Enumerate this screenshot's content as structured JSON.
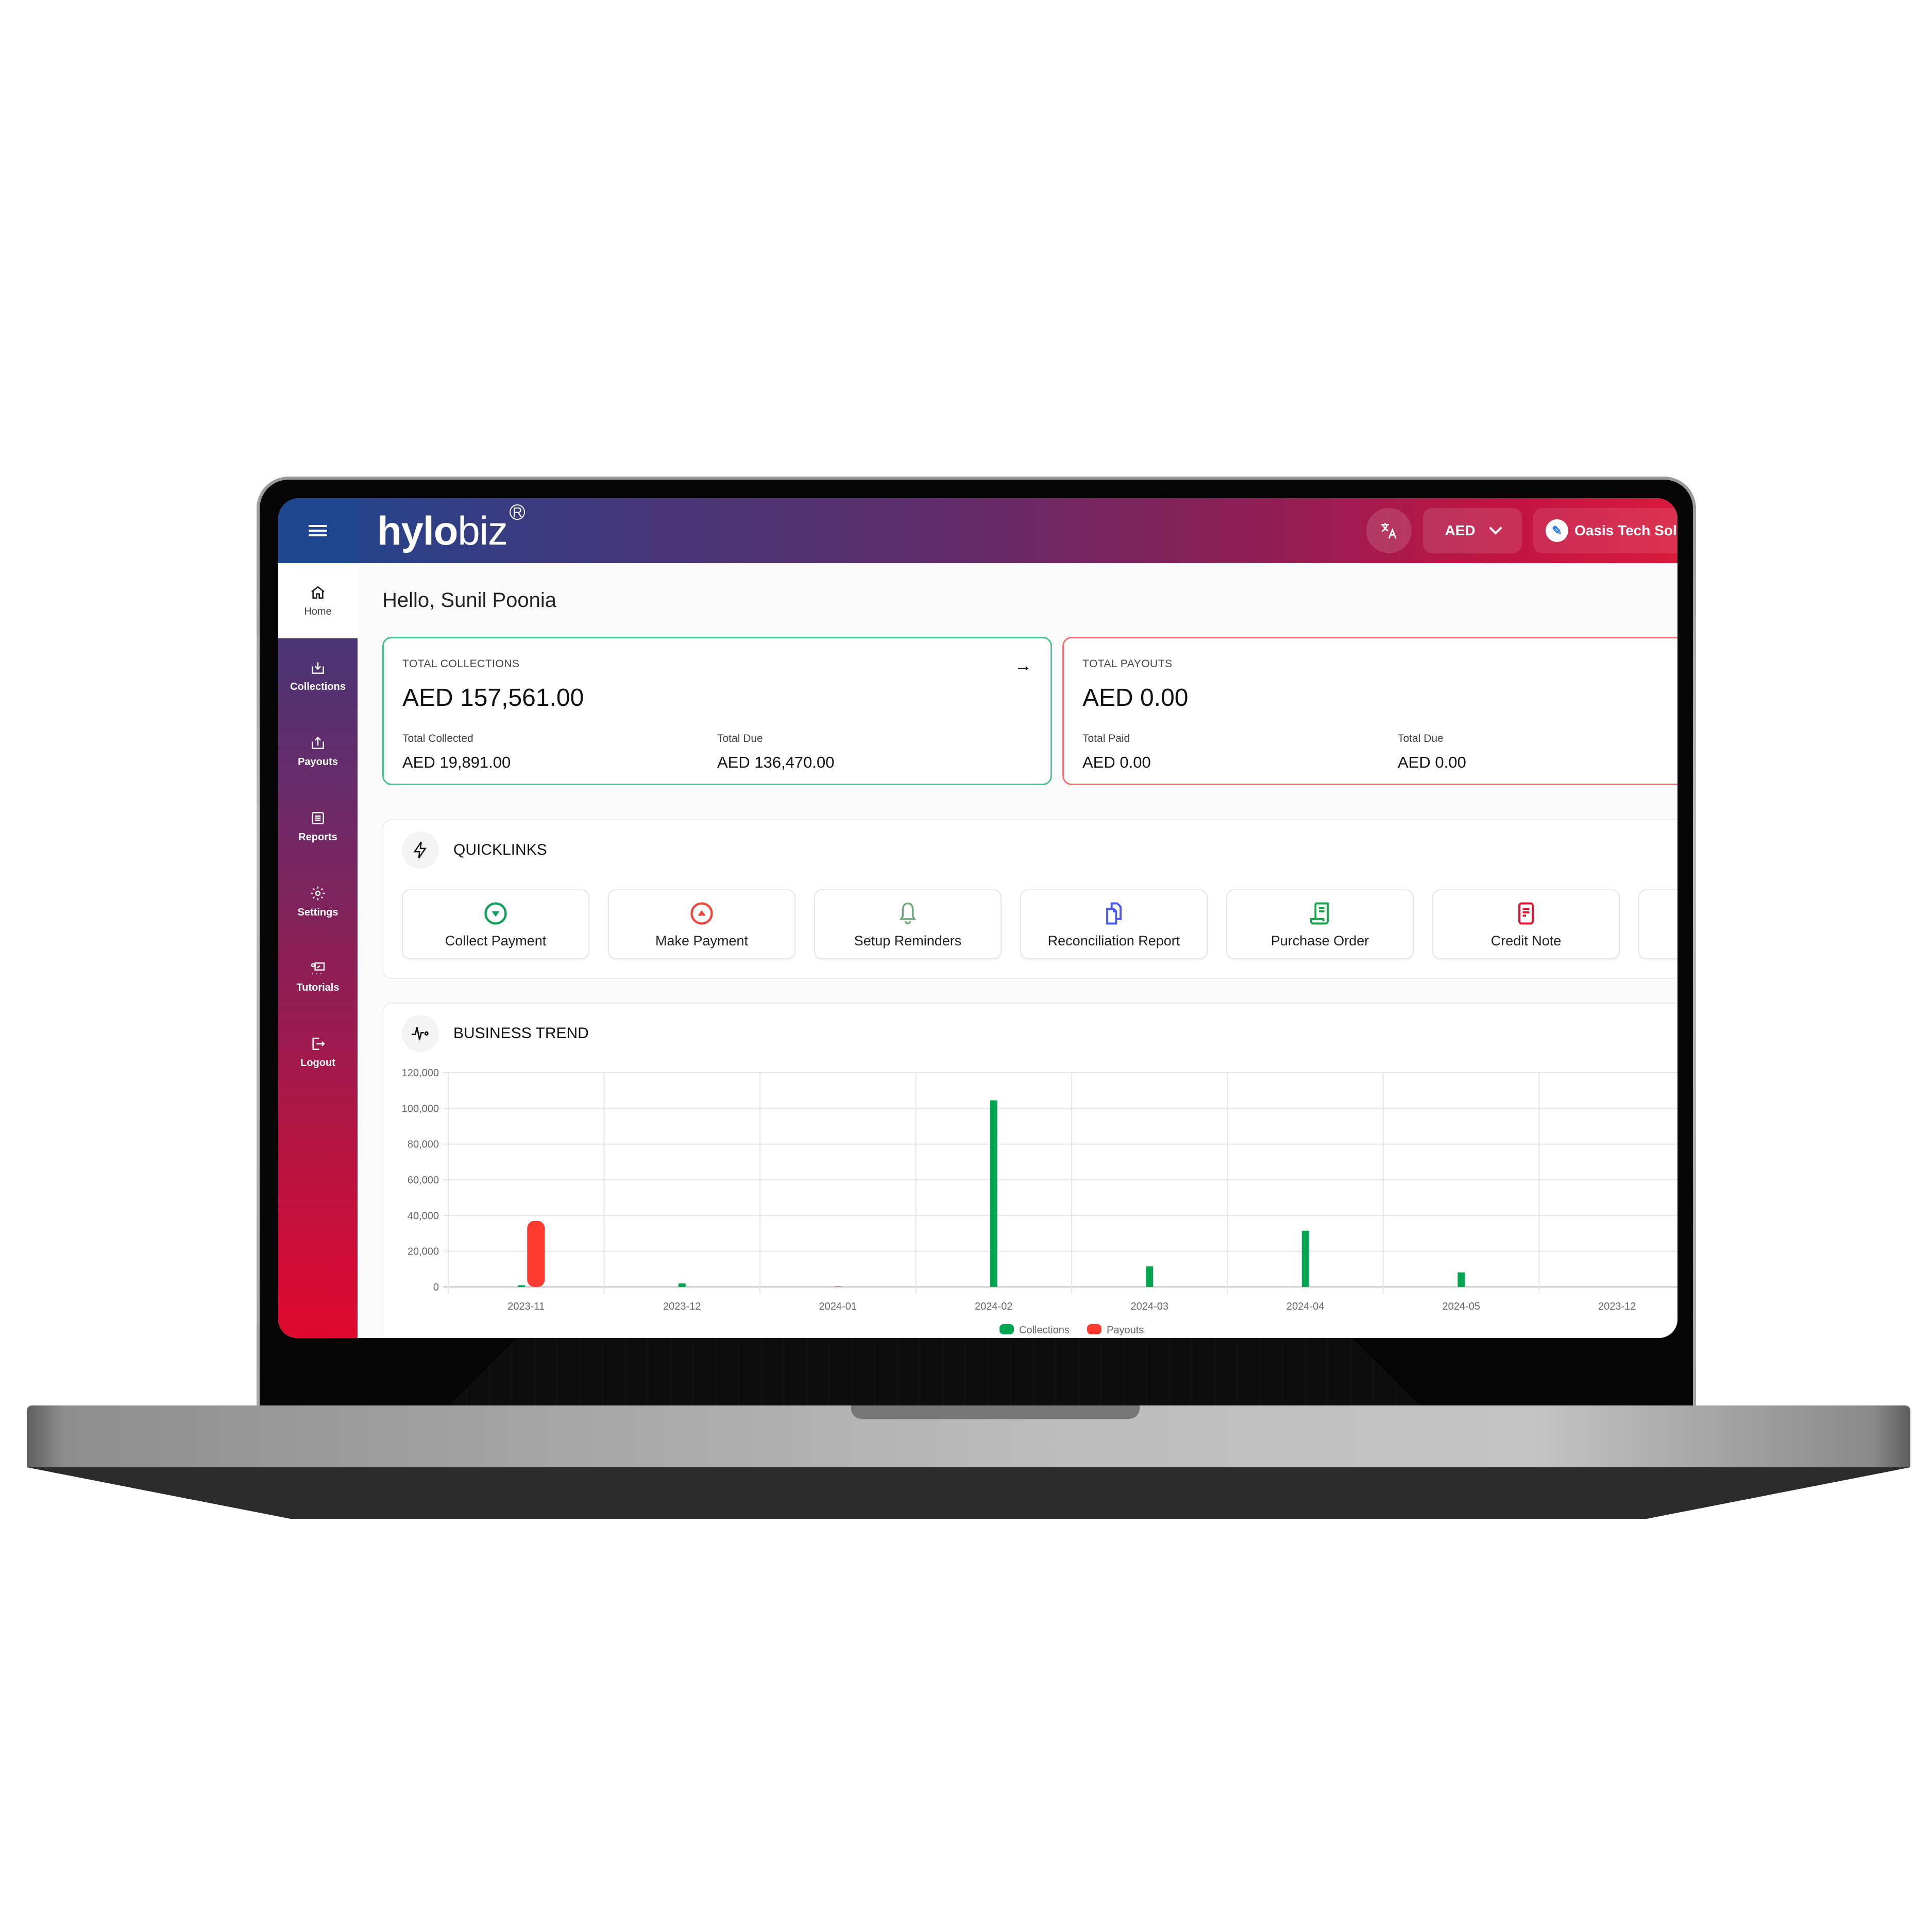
{
  "header": {
    "logo_bold": "hylo",
    "logo_light": "biz",
    "logo_mark": "R",
    "language_icon": "translate-icon",
    "currency": "AED",
    "organization": "Oasis Tech Solu"
  },
  "sidebar": {
    "items": [
      {
        "label": "Home",
        "icon": "home-icon",
        "active": true
      },
      {
        "label": "Collections",
        "icon": "download-tray-icon"
      },
      {
        "label": "Payouts",
        "icon": "upload-tray-icon"
      },
      {
        "label": "Reports",
        "icon": "list-doc-icon"
      },
      {
        "label": "Settings",
        "icon": "gear-icon"
      },
      {
        "label": "Tutorials",
        "icon": "presentation-icon"
      },
      {
        "label": "Logout",
        "icon": "logout-icon"
      }
    ]
  },
  "greeting": {
    "prefix": "Hello, ",
    "name": "Sunil Poonia"
  },
  "collections_card": {
    "label": "TOTAL COLLECTIONS",
    "total": "AED 157,561.00",
    "left_label": "Total Collected",
    "left_value": "AED 19,891.00",
    "right_label": "Total Due",
    "right_value": "AED 136,470.00",
    "accent": "#4dc28c"
  },
  "payouts_card": {
    "label": "TOTAL PAYOUTS",
    "total": "AED 0.00",
    "left_label": "Total Paid",
    "left_value": "AED 0.00",
    "right_label": "Total Due",
    "right_value": "AED 0.00",
    "accent": "#f07272"
  },
  "quicklinks": {
    "title": "QUICKLINKS",
    "items": [
      {
        "label": "Collect Payment",
        "icon": "collect-down-icon",
        "color": "#0f9d58"
      },
      {
        "label": "Make Payment",
        "icon": "pay-up-icon",
        "color": "#f0453a"
      },
      {
        "label": "Setup Reminders",
        "icon": "bell-icon",
        "color": "#6fa87a"
      },
      {
        "label": "Reconciliation Report",
        "icon": "documents-icon",
        "color": "#4a5cf0"
      },
      {
        "label": "Purchase Order",
        "icon": "receipt-icon",
        "color": "#17a34a"
      },
      {
        "label": "Credit Note",
        "icon": "note-icon",
        "color": "#e0112f"
      },
      {
        "label": "",
        "icon": "",
        "color": "#cccccc"
      }
    ]
  },
  "business_trend": {
    "title": "BUSINESS TREND"
  },
  "chart_data": {
    "type": "bar",
    "title": "BUSINESS TREND",
    "categories": [
      "2023-11",
      "2023-12",
      "2024-01",
      "2024-02",
      "2024-03",
      "2024-04",
      "2024-05",
      "2023-12"
    ],
    "series": [
      {
        "name": "Collections",
        "color": "#00a651",
        "values": [
          1000,
          2000,
          300,
          104500,
          11500,
          31500,
          8200,
          0
        ]
      },
      {
        "name": "Payouts",
        "color": "#ff3b30",
        "values": [
          37000,
          0,
          0,
          0,
          0,
          0,
          0,
          0
        ]
      }
    ],
    "yticks": [
      "0",
      "20,000",
      "40,000",
      "60,000",
      "80,000",
      "100,000",
      "120,000"
    ],
    "ylim": [
      0,
      120000
    ],
    "xlabel": "",
    "ylabel": "",
    "grid": true,
    "legend": "bottom-center"
  }
}
